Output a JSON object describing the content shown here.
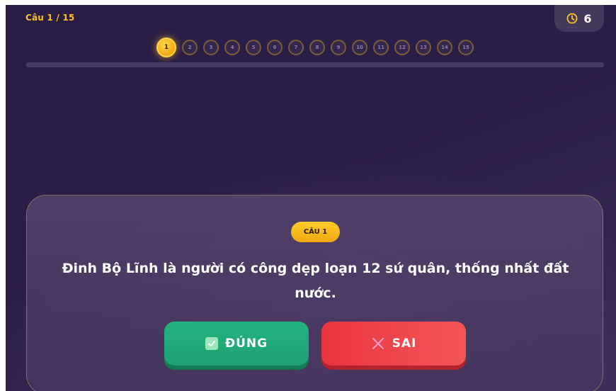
{
  "header": {
    "question_counter": "Câu 1 / 15",
    "timer": {
      "icon": "clock-icon",
      "value": "6"
    }
  },
  "steps": [
    "1",
    "2",
    "3",
    "4",
    "5",
    "6",
    "7",
    "8",
    "9",
    "10",
    "11",
    "12",
    "13",
    "14",
    "15"
  ],
  "active_step": 1,
  "question": {
    "badge": "CÂU 1",
    "text": "Đinh Bộ Lĩnh là người có công dẹp loạn 12 sứ quân, thống nhất đất nước."
  },
  "answers": {
    "true_label": "ĐÚNG",
    "true_icon": "check-icon",
    "false_label": "SAI",
    "false_icon": "close-icon"
  },
  "colors": {
    "accent": "#ffc21a",
    "true": "#1fa877",
    "false": "#ec3d46",
    "background": "#2b1e46"
  }
}
